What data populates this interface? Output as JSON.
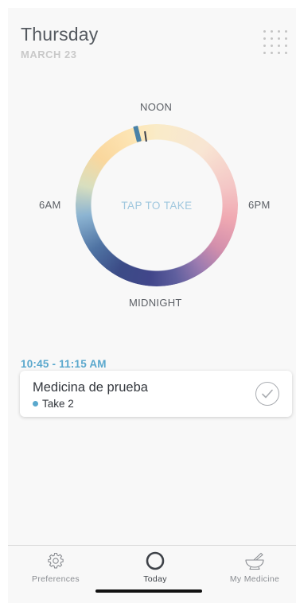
{
  "header": {
    "day": "Thursday",
    "date": "MARCH 23"
  },
  "clock": {
    "center_label": "TAP TO TAKE",
    "labels": {
      "top": "NOON",
      "right": "6PM",
      "bottom": "MIDNIGHT",
      "left": "6AM"
    }
  },
  "schedule": {
    "time_range": "10:45 - 11:15 AM",
    "dose": {
      "name": "Medicina de prueba",
      "take_label": "Take 2",
      "dot_color": "#5aa8cd"
    }
  },
  "tabs": [
    {
      "label": "Preferences",
      "icon": "gear-icon",
      "active": false
    },
    {
      "label": "Today",
      "icon": "circle-icon",
      "active": true
    },
    {
      "label": "My Medicine",
      "icon": "mortar-pestle-icon",
      "active": false
    }
  ],
  "colors": {
    "accent": "#5aa8cd",
    "title": "#555a60",
    "subtle": "#c9c9c9"
  }
}
